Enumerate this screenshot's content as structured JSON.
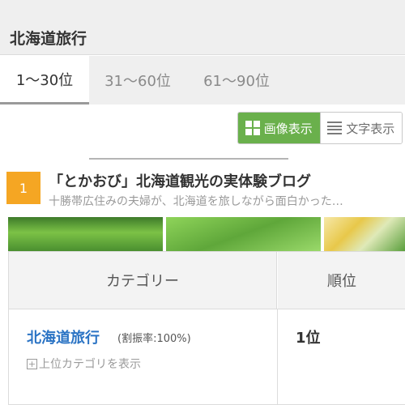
{
  "header": {
    "title": "北海道旅行"
  },
  "tabs": [
    {
      "label": "1〜30位",
      "active": true
    },
    {
      "label": "31〜60位",
      "active": false
    },
    {
      "label": "61〜90位",
      "active": false
    }
  ],
  "view_toggle": {
    "image_label": "画像表示",
    "text_label": "文字表示",
    "selected": "画像表示",
    "accent_color": "#6ab04c"
  },
  "entry": {
    "rank": "1",
    "title": "「とかおび」北海道観光の実体験ブログ",
    "description": "十勝帯広住みの夫婦が、北海道を旅しながら面白かった…",
    "badge_color": "#f5a623"
  },
  "table": {
    "headers": {
      "category": "カテゴリー",
      "rank": "順位"
    },
    "rows": [
      {
        "category": "北海道旅行",
        "rate": "(割振率:100%)",
        "expand_label": "上位カテゴリを表示",
        "rank": "1位"
      }
    ],
    "link_color": "#2a73c4"
  }
}
